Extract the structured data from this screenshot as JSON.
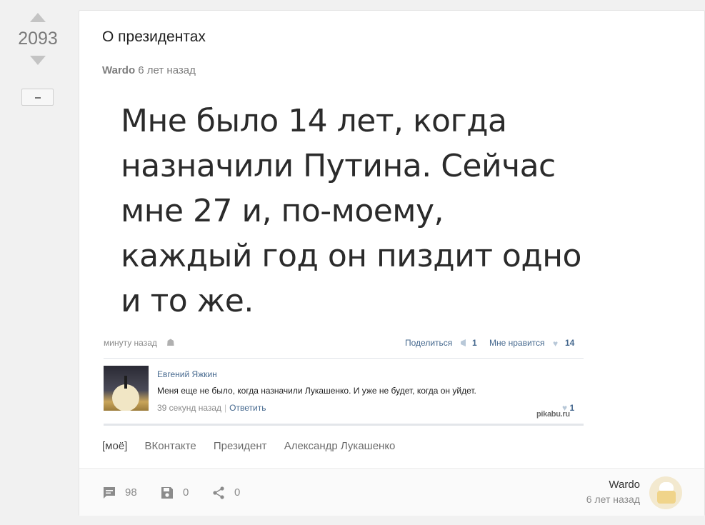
{
  "rating": {
    "count": "2093"
  },
  "story": {
    "title": "О президентах",
    "author": "Wardo",
    "time": "6 лет назад"
  },
  "screenshot": {
    "quote_lines": [
      "Мне было 14 лет, когда",
      "назначили Путина. Сейчас",
      "мне 27 и, по-моему,",
      "каждый год он пиздит одно",
      "и то же."
    ],
    "post_time": "минуту назад",
    "share_label": "Поделиться",
    "share_count": "1",
    "like_label": "Мне нравится",
    "like_count": "14",
    "comment": {
      "name": "Евгений Яжкин",
      "text": "Меня еще не было, когда назначили Лукашенко. И уже не будет, когда он уйдет.",
      "time": "39 секунд назад",
      "separator": "|",
      "reply": "Ответить",
      "likes": "1"
    },
    "watermark": "pikabu.ru"
  },
  "tags": [
    "[моё]",
    "ВКонтакте",
    "Президент",
    "Александр Лукашенко"
  ],
  "footer": {
    "comments": "98",
    "saves": "0",
    "shares": "0",
    "author": "Wardo",
    "time": "6 лет назад"
  }
}
